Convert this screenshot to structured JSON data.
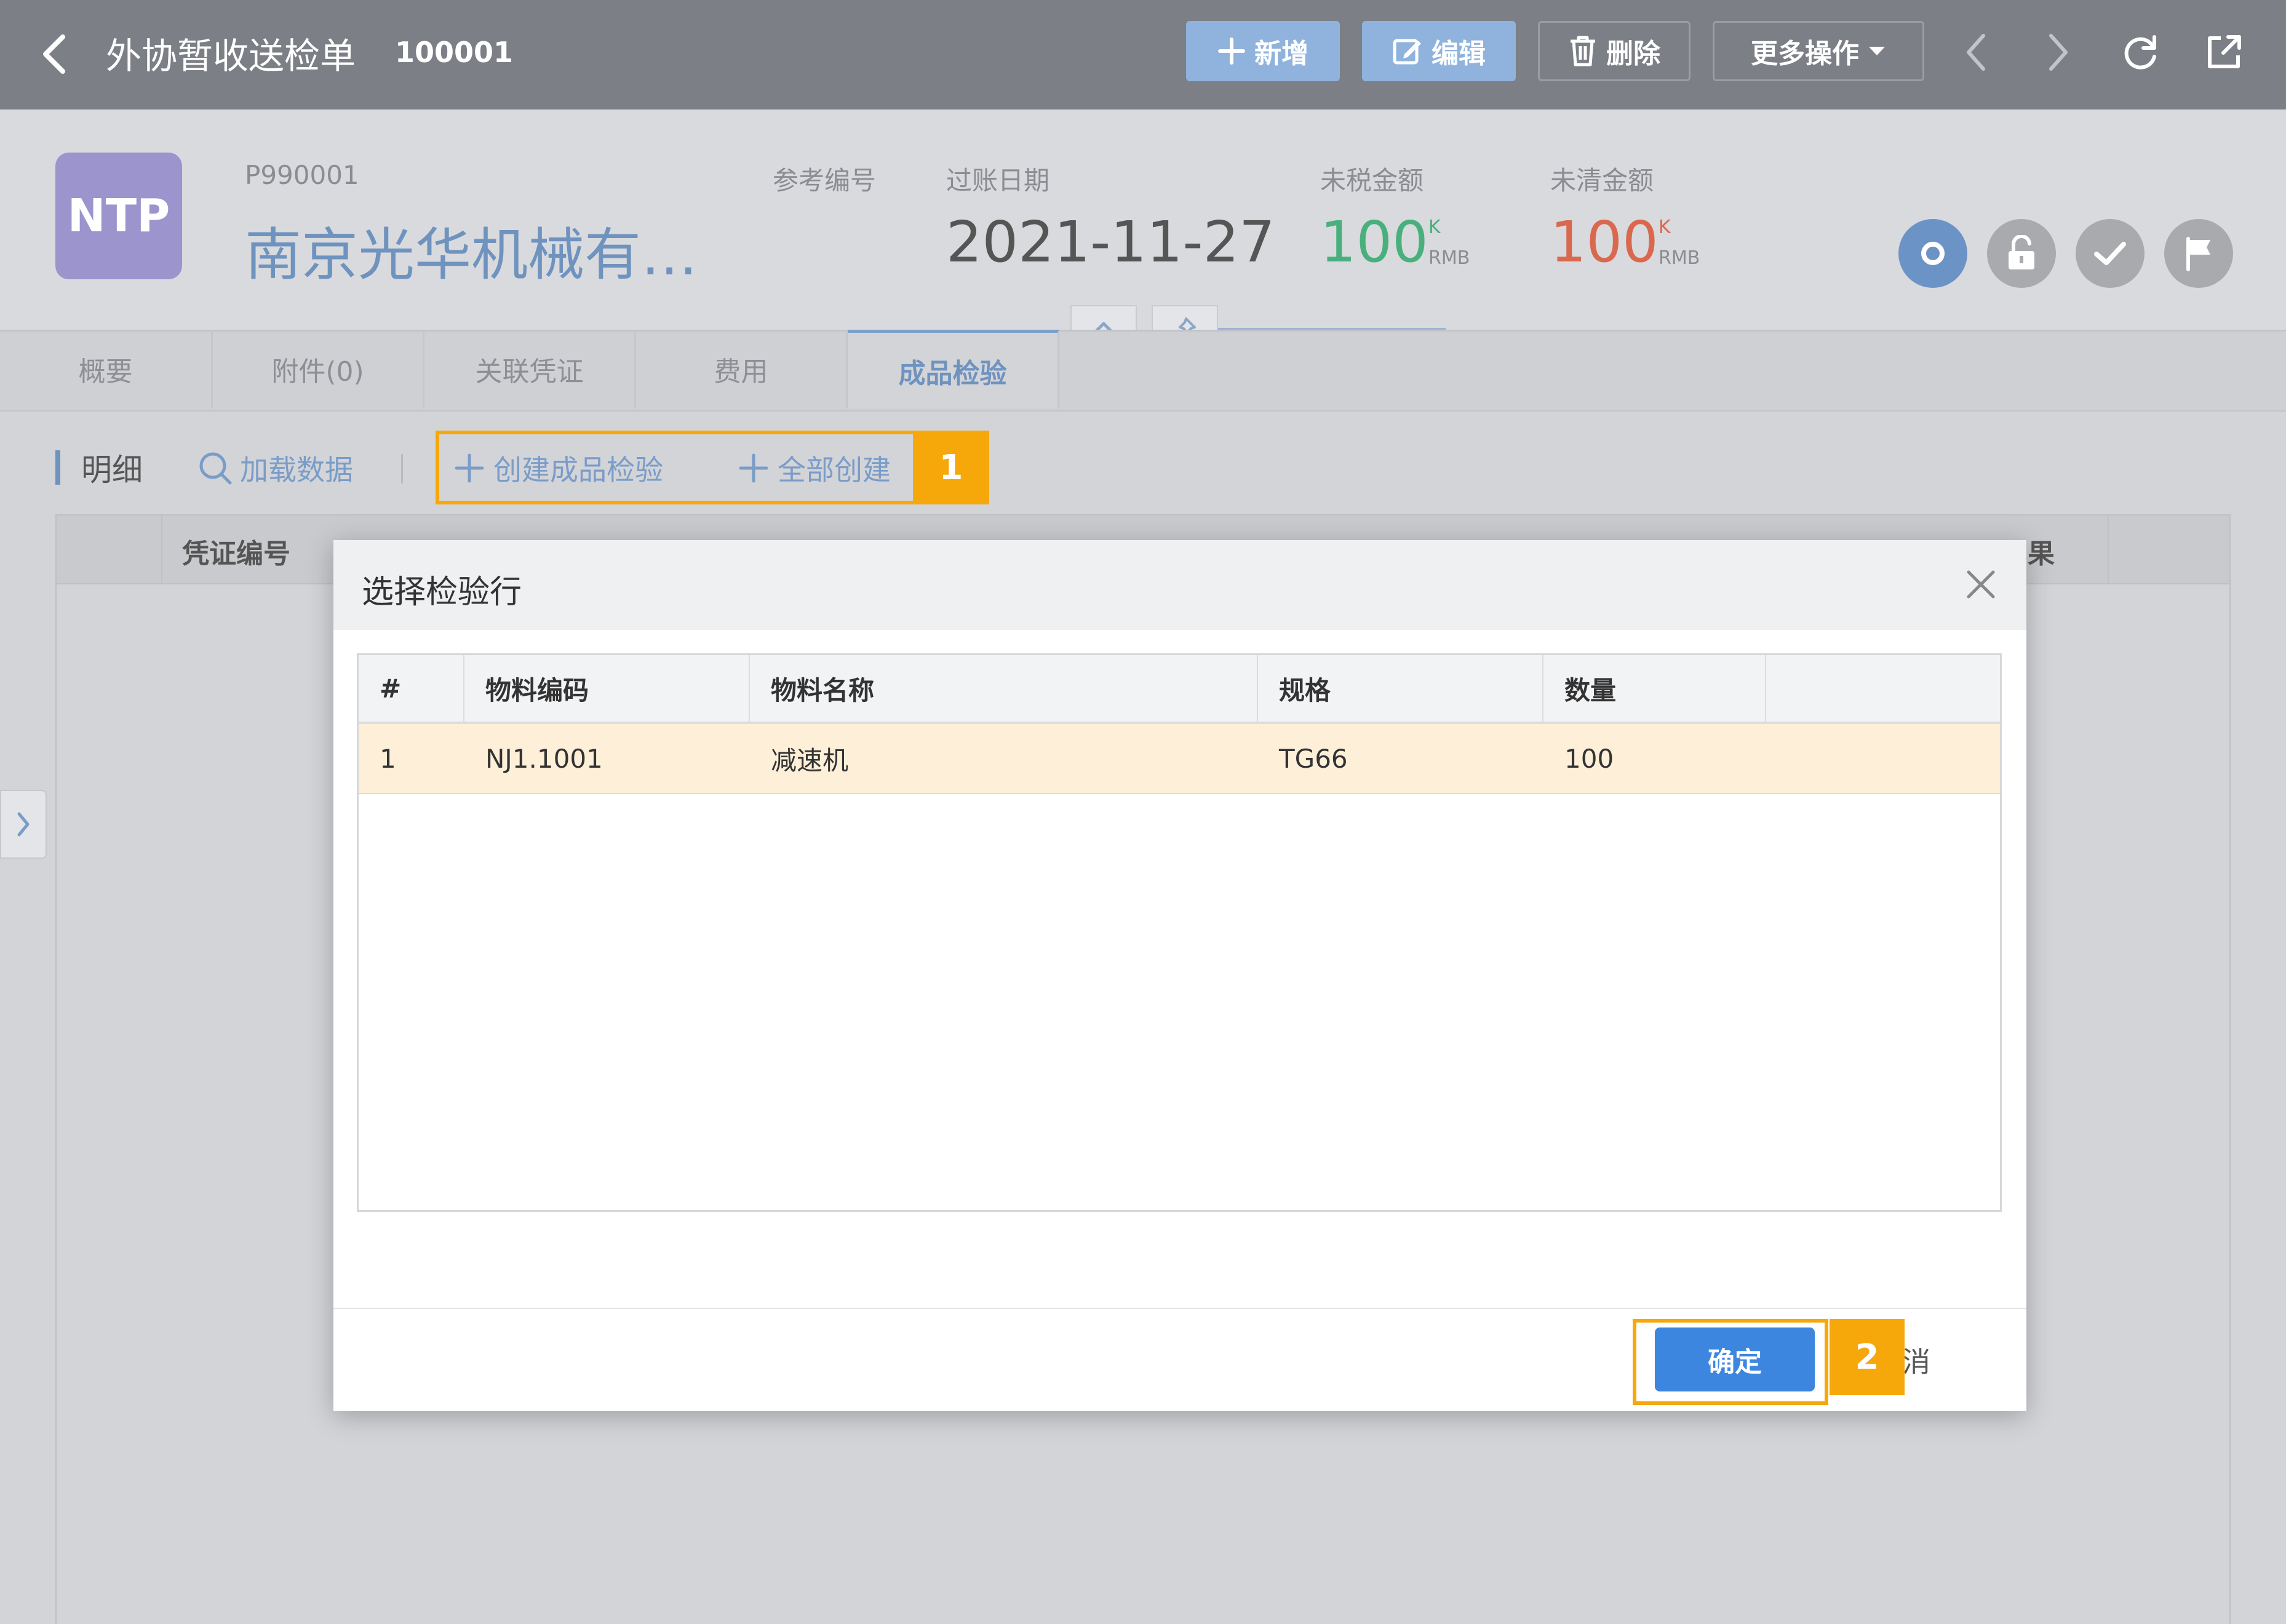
{
  "topbar": {
    "title": "外协暂收送检单",
    "doc_no": "100001",
    "buttons": {
      "new": "新增",
      "edit": "编辑",
      "delete": "删除",
      "more": "更多操作"
    }
  },
  "header": {
    "avatar": "NTP",
    "code": "P990001",
    "company": "南京光华机械有…",
    "ref_label": "参考编号",
    "date_label": "过账日期",
    "date_value": "2021-11-27",
    "untaxed_label": "未税金额",
    "untaxed_value": "100",
    "untaxed_unit": "K",
    "untaxed_currency": "RMB",
    "uncleared_label": "未清金额",
    "uncleared_value": "100",
    "uncleared_unit": "K",
    "uncleared_currency": "RMB"
  },
  "tabs": [
    "概要",
    "附件(0)",
    "关联凭证",
    "费用",
    "成品检验"
  ],
  "detail": {
    "section": "明细",
    "load": "加载数据",
    "create": "创建成品检验",
    "create_all": "全部创建",
    "grid_header_doc": "凭证编号",
    "grid_header_result_tail": "果"
  },
  "modal": {
    "title": "选择检验行",
    "columns": [
      "#",
      "物料编码",
      "物料名称",
      "规格",
      "数量"
    ],
    "rows": [
      {
        "no": "1",
        "code": "NJ1.1001",
        "name": "减速机",
        "spec": "TG66",
        "qty": "100"
      }
    ],
    "ok": "确定",
    "cancel": "取消"
  },
  "callouts": [
    "1",
    "2"
  ],
  "colors": {
    "topbar": "#7c7f86",
    "primary": "#3d86e0",
    "green_amount": "#49b07d",
    "red_amount": "#d9684f",
    "callout": "#f6a80b",
    "selected_row": "#fdefd8"
  }
}
